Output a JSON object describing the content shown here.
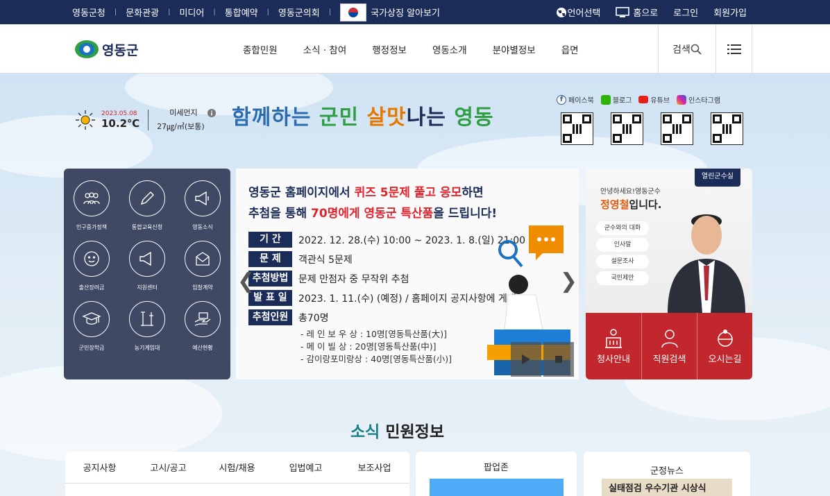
{
  "topbar": {
    "links": [
      "영동군청",
      "문화관광",
      "미디어",
      "통합예약",
      "영동군의회"
    ],
    "national_symbol": "국가상징 알아보기",
    "language": "언어선택",
    "home": "홈으로",
    "login": "로그인",
    "signup": "회원가입"
  },
  "header": {
    "logo_text": "영동군",
    "nav": [
      "종합민원",
      "소식 · 참여",
      "행정정보",
      "영동소개",
      "분야별정보",
      "읍면"
    ],
    "search_label": "검색"
  },
  "weather": {
    "date": "2023.05.08",
    "temperature": "10.2℃",
    "dust_label": "미세먼지",
    "dust_value": "27㎍/㎥(보통)"
  },
  "slogan": {
    "w1": "함께하는",
    "w2": "군민",
    "w3": "살맛",
    "w4": "나는",
    "w5": "영동"
  },
  "sns": {
    "items": [
      "페이스북",
      "블로그",
      "유튜브",
      "인스타그램"
    ]
  },
  "quick_menu": [
    "인구증가정책",
    "통합교육신청",
    "영동소식",
    "출산장려금",
    "지원센터",
    "입찰계약",
    "군민장학금",
    "농기계임대",
    "예산현황"
  ],
  "banner": {
    "line1a": "영동군 홈페이지에서 ",
    "line1b": "퀴즈 5문제 풀고 응모",
    "line1c": "하면",
    "line2a": "추첨을 통해 ",
    "line2b": "70명에게 영동군 특산품",
    "line2c": "을 드립니다!",
    "rows": [
      {
        "label": "기 간",
        "value": "2022. 12. 28.(수) 10:00 ~ 2023. 1. 8.(일) 21:00"
      },
      {
        "label": "문 제",
        "value": "객관식 5문제"
      },
      {
        "label": "추첨방법",
        "value": "문제 만점자 중 무작위 추첨"
      },
      {
        "label": "발 표 일",
        "value": "2023. 1. 11.(수) (예정) / 홈페이지 공지사항에 게재"
      },
      {
        "label": "추첨인원",
        "value": "총70명"
      }
    ],
    "sub": [
      "- 레 인 보 우 상 : 10명[영동특산품(大)]",
      "- 메 이 빌 상 : 20명[영동특산품(中)]",
      "- 감이랑포미랑상 : 40명[영동특산품(小)]"
    ]
  },
  "governor": {
    "tag": "열린군수실",
    "greeting": "안녕하세요!영동군수",
    "name": "정영철",
    "suffix": "입니다.",
    "buttons": [
      "군수와의 대화",
      "인사말",
      "설문조사",
      "국민제안"
    ],
    "bottom": [
      "청사안내",
      "직원검색",
      "오시는길"
    ]
  },
  "section": {
    "title_a": "소식",
    "title_b": " 민원정보"
  },
  "notice_tabs": [
    "공지사항",
    "고시/공고",
    "시험/채용",
    "입법예고",
    "보조사업"
  ],
  "popup": {
    "title": "팝업존"
  },
  "news": {
    "title": "군정뉴스",
    "caption": "실태점검 우수기관 시상식"
  }
}
